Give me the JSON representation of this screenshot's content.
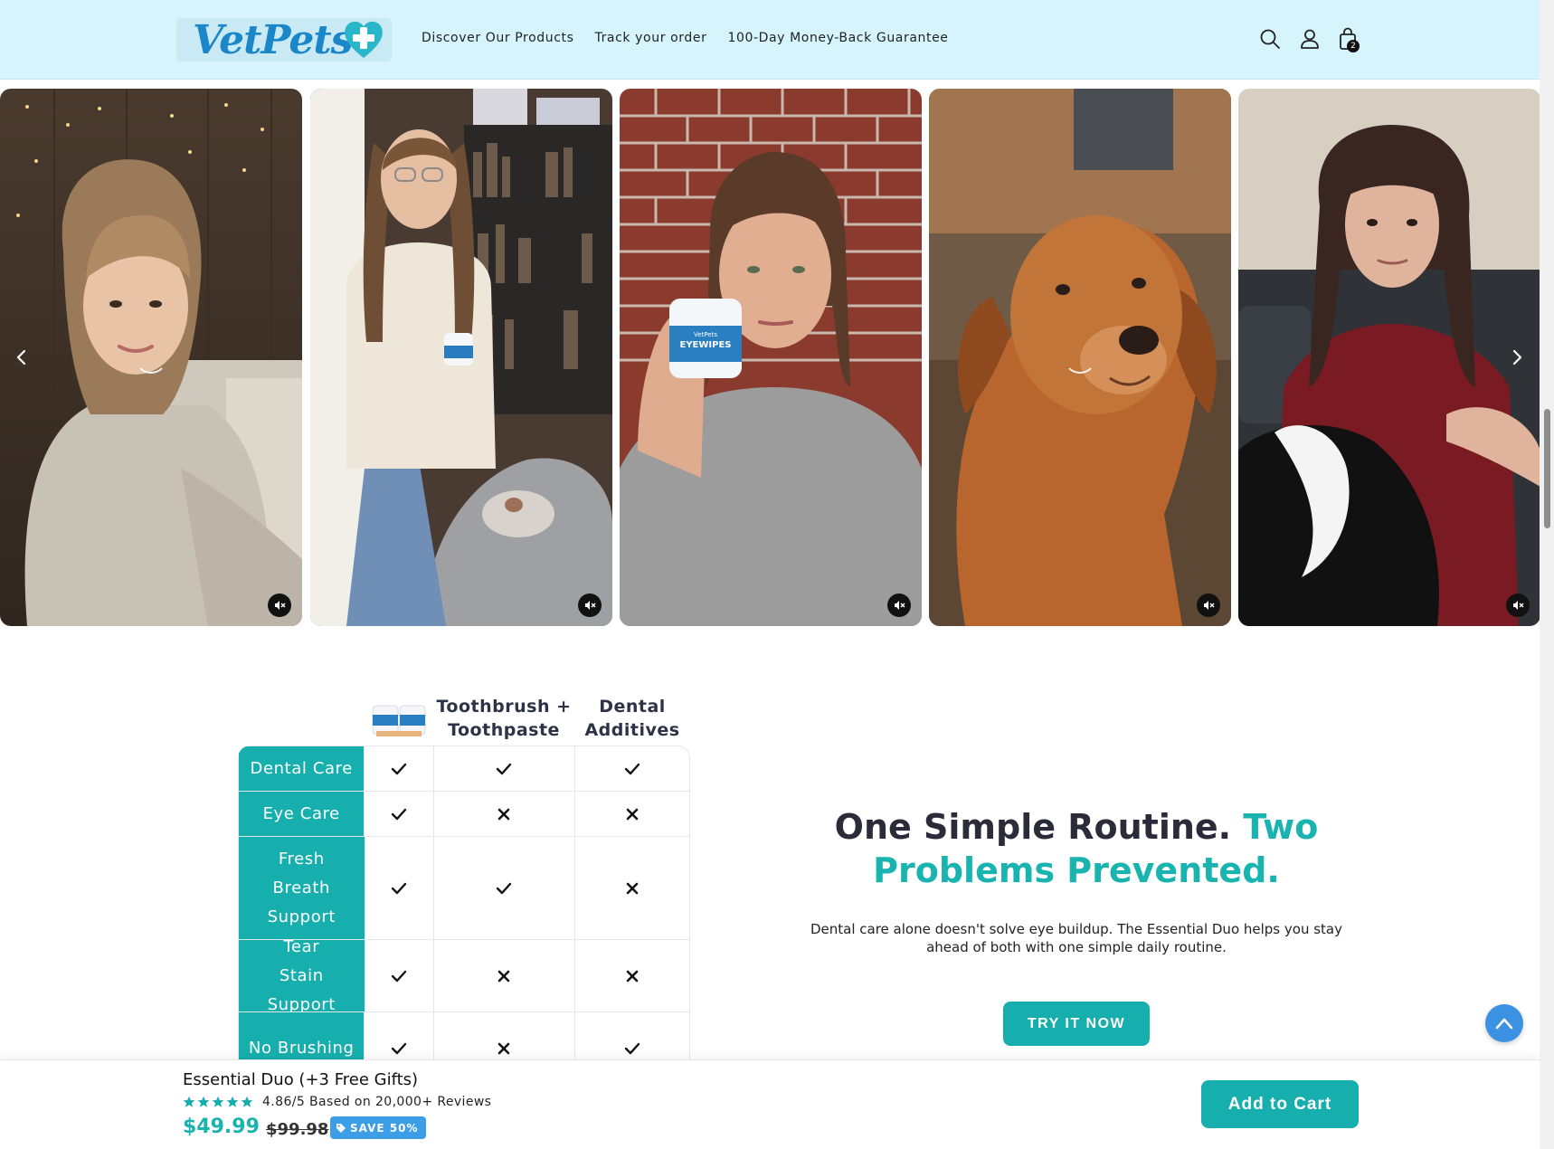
{
  "colors": {
    "header_bg": "#d6f4fc",
    "accent_teal": "#17afad",
    "brand_blue": "#1b86c8",
    "badge_blue": "#3b9ee7"
  },
  "header": {
    "logo": "VetPets",
    "nav": [
      "Discover Our Products",
      "Track your order",
      "100-Day Money-Back Guarantee"
    ],
    "icons": [
      "search-icon",
      "account-icon",
      "cart-icon"
    ],
    "cart_count": "2"
  },
  "carousel": {
    "videos": [
      {
        "subject": "woman in hoodie",
        "muted": true
      },
      {
        "subject": "woman holding product jar",
        "muted": true
      },
      {
        "subject": "woman holding EyeWipes jar",
        "muted": true
      },
      {
        "subject": "golden retriever",
        "muted": true
      },
      {
        "subject": "woman with dog",
        "muted": true
      }
    ],
    "product_jar_label": "EYEWIPES",
    "product_jar_brand": "VetPets"
  },
  "comparison": {
    "columns": [
      "Toothbrush + Toothpaste",
      "Dental Additives"
    ],
    "rows": [
      {
        "label": "Dental Care",
        "values": [
          "check",
          "check",
          "check"
        ]
      },
      {
        "label": "Eye Care",
        "values": [
          "check",
          "cross",
          "cross"
        ]
      },
      {
        "label": "Fresh Breath Support",
        "values": [
          "check",
          "check",
          "cross"
        ]
      },
      {
        "label": "Tear Stain Support",
        "values": [
          "check",
          "cross",
          "cross"
        ]
      },
      {
        "label": "No Brushing",
        "values": [
          "check",
          "cross",
          "check"
        ]
      }
    ]
  },
  "promo": {
    "title_part1": "One Simple Routine.",
    "title_part2": "Two Problems Prevented.",
    "description": "Dental care alone doesn't solve eye buildup. The Essential Duo helps you stay ahead of both with one simple daily routine.",
    "cta": "TRY IT NOW"
  },
  "sticky_bar": {
    "title": "Essential Duo (+3 Free Gifts)",
    "rating": 4.86,
    "rating_text": "4.86/5 Based on 20,000+ Reviews",
    "price": "$49.99",
    "old_price": "$99.98",
    "badge": "SAVE 50%",
    "button": "Add to Cart"
  }
}
